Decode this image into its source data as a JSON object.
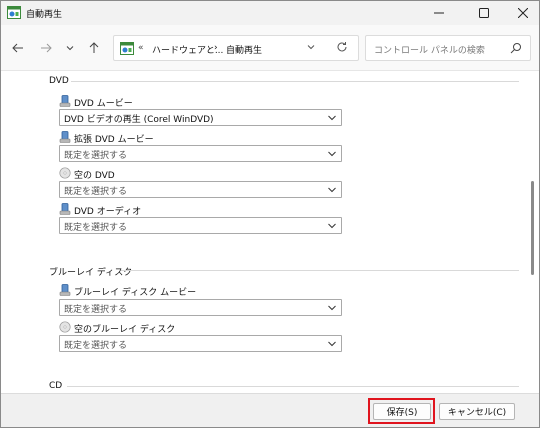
{
  "window": {
    "title": "自動再生"
  },
  "nav": {
    "address_overflow": "«",
    "address_parent": "ハードウェアと...",
    "address_separator": "›",
    "address_current": "自動再生",
    "search_placeholder": "コントロール パネルの検索"
  },
  "sections": [
    {
      "label": "DVD",
      "items": [
        {
          "label": "DVD ムービー",
          "value": "DVD ビデオの再生 (Corel WinDVD)",
          "icon": "dvd-movie-icon"
        },
        {
          "label": "拡張 DVD ムービー",
          "value": "既定を選択する",
          "icon": "enhanced-dvd-icon"
        },
        {
          "label": "空の DVD",
          "value": "既定を選択する",
          "icon": "blank-disc-icon"
        },
        {
          "label": "DVD オーディオ",
          "value": "既定を選択する",
          "icon": "dvd-audio-icon"
        }
      ]
    },
    {
      "label": "ブルーレイ ディスク",
      "items": [
        {
          "label": "ブルーレイ ディスク ムービー",
          "value": "既定を選択する",
          "icon": "bluray-movie-icon"
        },
        {
          "label": "空のブルーレイ ディスク",
          "value": "既定を選択する",
          "icon": "blank-disc-icon"
        }
      ]
    },
    {
      "label": "CD",
      "items": []
    }
  ],
  "footer": {
    "save_label": "保存(S)",
    "cancel_label": "キャンセル(C)"
  },
  "colors": {
    "highlight": "#e0141e"
  }
}
